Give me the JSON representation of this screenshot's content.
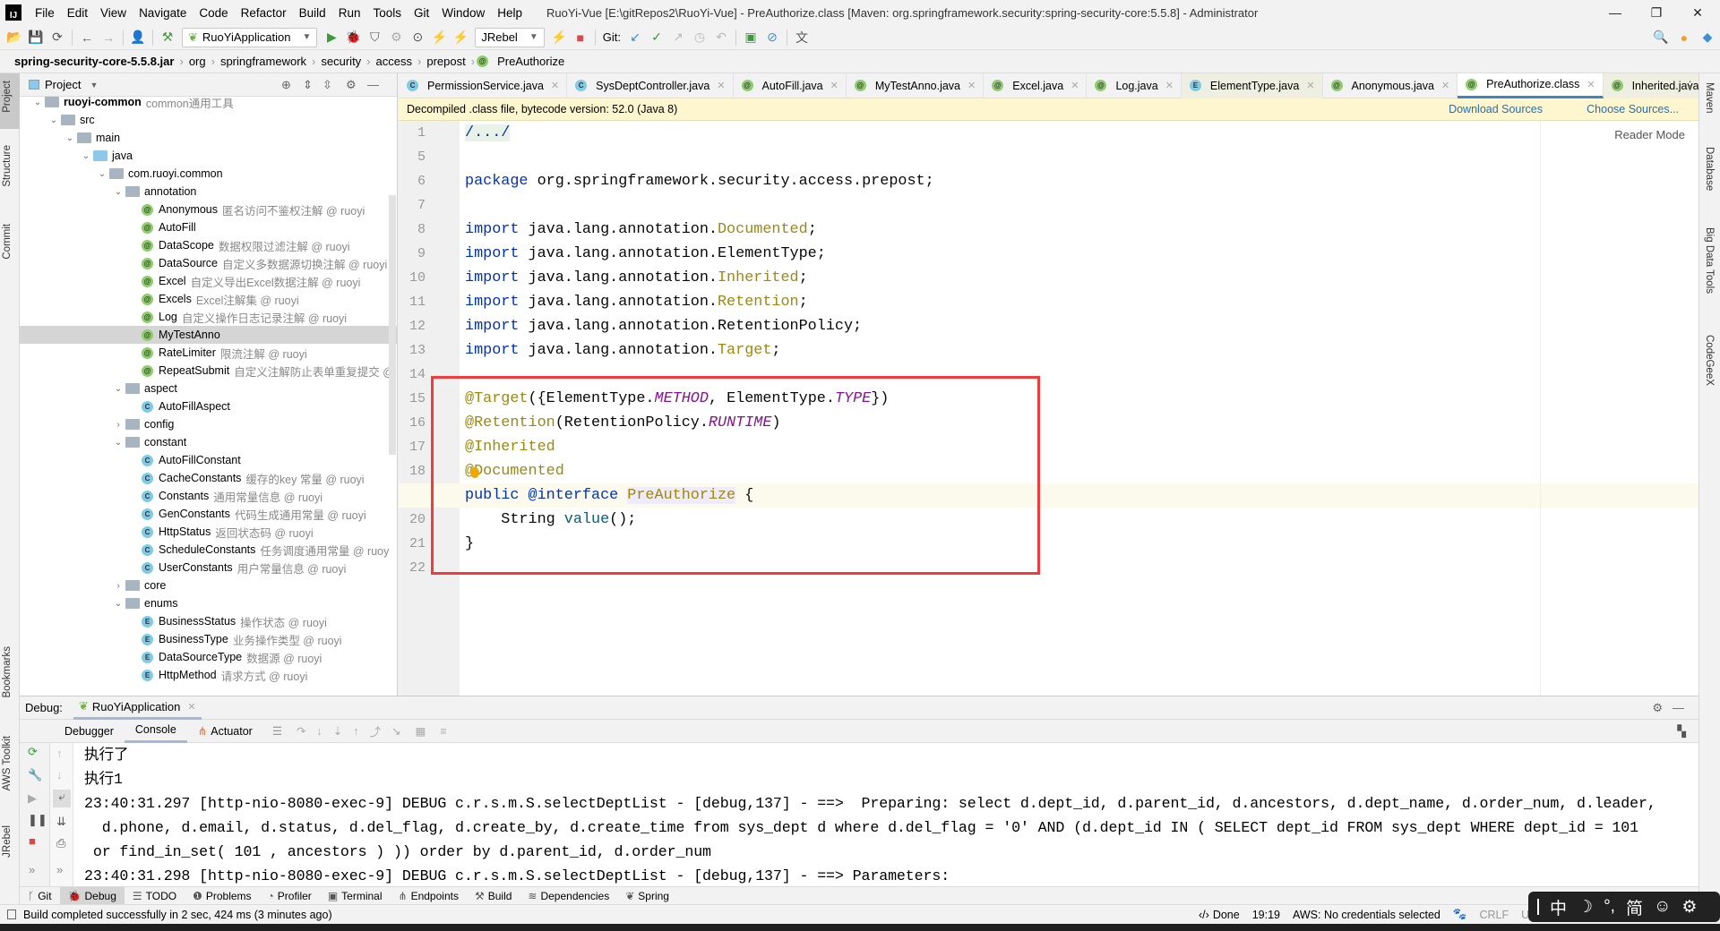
{
  "window": {
    "title": "RuoYi-Vue [E:\\gitRepos2\\RuoYi-Vue] - PreAuthorize.class [Maven: org.springframework.security:spring-security-core:5.5.8] - Administrator",
    "logo": "IJ"
  },
  "menu": [
    "File",
    "Edit",
    "View",
    "Navigate",
    "Code",
    "Refactor",
    "Build",
    "Run",
    "Tools",
    "Git",
    "Window",
    "Help"
  ],
  "toolbar": {
    "run_config": "RuoYiApplication",
    "jrebel": "JRebel",
    "git_label": "Git:"
  },
  "breadcrumb": [
    "spring-security-core-5.5.8.jar",
    "org",
    "springframework",
    "security",
    "access",
    "prepost",
    "PreAuthorize"
  ],
  "left_strip": [
    "Project",
    "Structure",
    "Commit",
    "Bookmarks",
    "AWS Toolkit",
    "JRebel"
  ],
  "right_strip": [
    "Maven",
    "Database",
    "Big Data Tools",
    "CodeGeeX"
  ],
  "project": {
    "title": "Project",
    "tree": [
      {
        "depth": 0,
        "kind": "module",
        "arrow": "down",
        "name": "ruoyi-common",
        "desc": "common通用工具"
      },
      {
        "depth": 1,
        "kind": "folder",
        "arrow": "down",
        "name": "src",
        "desc": ""
      },
      {
        "depth": 2,
        "kind": "folder",
        "arrow": "down",
        "name": "main",
        "desc": ""
      },
      {
        "depth": 3,
        "kind": "src",
        "arrow": "down",
        "name": "java",
        "desc": ""
      },
      {
        "depth": 4,
        "kind": "folder",
        "arrow": "down",
        "name": "com.ruoyi.common",
        "desc": ""
      },
      {
        "depth": 5,
        "kind": "folder",
        "arrow": "down",
        "name": "annotation",
        "desc": ""
      },
      {
        "depth": 6,
        "kind": "a",
        "name": "Anonymous",
        "desc": "匿名访问不鉴权注解 @ ruoyi"
      },
      {
        "depth": 6,
        "kind": "a",
        "name": "AutoFill",
        "desc": ""
      },
      {
        "depth": 6,
        "kind": "a",
        "name": "DataScope",
        "desc": "数据权限过滤注解 @ ruoyi"
      },
      {
        "depth": 6,
        "kind": "a",
        "name": "DataSource",
        "desc": "自定义多数据源切换注解 @ ruoyi"
      },
      {
        "depth": 6,
        "kind": "a",
        "name": "Excel",
        "desc": "自定义导出Excel数据注解 @ ruoyi"
      },
      {
        "depth": 6,
        "kind": "a",
        "name": "Excels",
        "desc": "Excel注解集 @ ruoyi"
      },
      {
        "depth": 6,
        "kind": "a",
        "name": "Log",
        "desc": "自定义操作日志记录注解 @ ruoyi"
      },
      {
        "depth": 6,
        "kind": "a",
        "name": "MyTestAnno",
        "desc": "",
        "selected": true
      },
      {
        "depth": 6,
        "kind": "a",
        "name": "RateLimiter",
        "desc": "限流注解 @ ruoyi"
      },
      {
        "depth": 6,
        "kind": "a",
        "name": "RepeatSubmit",
        "desc": "自定义注解防止表单重复提交 @"
      },
      {
        "depth": 5,
        "kind": "folder",
        "arrow": "down",
        "name": "aspect",
        "desc": ""
      },
      {
        "depth": 6,
        "kind": "c",
        "name": "AutoFillAspect",
        "desc": ""
      },
      {
        "depth": 5,
        "kind": "folder",
        "arrow": "right",
        "name": "config",
        "desc": ""
      },
      {
        "depth": 5,
        "kind": "folder",
        "arrow": "down",
        "name": "constant",
        "desc": ""
      },
      {
        "depth": 6,
        "kind": "c",
        "name": "AutoFillConstant",
        "desc": ""
      },
      {
        "depth": 6,
        "kind": "c",
        "name": "CacheConstants",
        "desc": "缓存的key 常量 @ ruoyi"
      },
      {
        "depth": 6,
        "kind": "c",
        "name": "Constants",
        "desc": "通用常量信息 @ ruoyi"
      },
      {
        "depth": 6,
        "kind": "c",
        "name": "GenConstants",
        "desc": "代码生成通用常量 @ ruoyi"
      },
      {
        "depth": 6,
        "kind": "c",
        "name": "HttpStatus",
        "desc": "返回状态码 @ ruoyi"
      },
      {
        "depth": 6,
        "kind": "c",
        "name": "ScheduleConstants",
        "desc": "任务调度通用常量 @ ruoy"
      },
      {
        "depth": 6,
        "kind": "c",
        "name": "UserConstants",
        "desc": "用户常量信息 @ ruoyi"
      },
      {
        "depth": 5,
        "kind": "folder",
        "arrow": "right",
        "name": "core",
        "desc": ""
      },
      {
        "depth": 5,
        "kind": "folder",
        "arrow": "down",
        "name": "enums",
        "desc": ""
      },
      {
        "depth": 6,
        "kind": "e",
        "name": "BusinessStatus",
        "desc": "操作状态 @ ruoyi"
      },
      {
        "depth": 6,
        "kind": "e",
        "name": "BusinessType",
        "desc": "业务操作类型 @ ruoyi"
      },
      {
        "depth": 6,
        "kind": "e",
        "name": "DataSourceType",
        "desc": "数据源 @ ruoyi"
      },
      {
        "depth": 6,
        "kind": "e",
        "name": "HttpMethod",
        "desc": "请求方式 @ ruoyi"
      }
    ]
  },
  "tabs": [
    {
      "label": "PermissionService.java",
      "kind": "c"
    },
    {
      "label": "SysDeptController.java",
      "kind": "c"
    },
    {
      "label": "AutoFill.java",
      "kind": "a"
    },
    {
      "label": "MyTestAnno.java",
      "kind": "a"
    },
    {
      "label": "Excel.java",
      "kind": "a"
    },
    {
      "label": "Log.java",
      "kind": "a"
    },
    {
      "label": "ElementType.java",
      "kind": "e",
      "yellow": true
    },
    {
      "label": "Anonymous.java",
      "kind": "a"
    },
    {
      "label": "PreAuthorize.class",
      "kind": "a",
      "active": true
    },
    {
      "label": "Inherited.java",
      "kind": "a",
      "yellow": true
    }
  ],
  "banner": {
    "text": "Decompiled .class file, bytecode version: 52.0 (Java 8)",
    "download": "Download Sources",
    "choose": "Choose Sources..."
  },
  "editor": {
    "reader_mode": "Reader Mode",
    "current_line": 19,
    "lines": [
      {
        "n": 1,
        "t": [
          [
            "/.../",
            "fold"
          ]
        ]
      },
      {
        "n": 5,
        "t": []
      },
      {
        "n": 6,
        "t": [
          [
            "package ",
            "kw"
          ],
          [
            "org.springframework.security.access.prepost;",
            ""
          ]
        ]
      },
      {
        "n": 7,
        "t": []
      },
      {
        "n": 8,
        "t": [
          [
            "import ",
            "kw"
          ],
          [
            "java.lang.annotation.",
            ""
          ],
          [
            "Documented",
            "cls"
          ],
          [
            ";",
            ""
          ]
        ]
      },
      {
        "n": 9,
        "t": [
          [
            "import ",
            "kw"
          ],
          [
            "java.lang.annotation.ElementType;",
            ""
          ]
        ]
      },
      {
        "n": 10,
        "t": [
          [
            "import ",
            "kw"
          ],
          [
            "java.lang.annotation.",
            ""
          ],
          [
            "Inherited",
            "cls"
          ],
          [
            ";",
            ""
          ]
        ]
      },
      {
        "n": 11,
        "t": [
          [
            "import ",
            "kw"
          ],
          [
            "java.lang.annotation.",
            ""
          ],
          [
            "Retention",
            "cls"
          ],
          [
            ";",
            ""
          ]
        ]
      },
      {
        "n": 12,
        "t": [
          [
            "import ",
            "kw"
          ],
          [
            "java.lang.annotation.RetentionPolicy;",
            ""
          ]
        ]
      },
      {
        "n": 13,
        "t": [
          [
            "import ",
            "kw"
          ],
          [
            "java.lang.annotation.",
            ""
          ],
          [
            "Target",
            "cls"
          ],
          [
            ";",
            ""
          ]
        ]
      },
      {
        "n": 14,
        "t": []
      },
      {
        "n": 15,
        "t": [
          [
            "@Target",
            "ann"
          ],
          [
            "({ElementType.",
            ""
          ],
          [
            "METHOD",
            "const"
          ],
          [
            ", ElementType.",
            ""
          ],
          [
            "TYPE",
            "const"
          ],
          [
            "})",
            ""
          ]
        ]
      },
      {
        "n": 16,
        "t": [
          [
            "@Retention",
            "ann"
          ],
          [
            "(RetentionPolicy.",
            ""
          ],
          [
            "RUNTIME",
            "const"
          ],
          [
            ")",
            ""
          ]
        ]
      },
      {
        "n": 17,
        "t": [
          [
            "@Inherited",
            "ann"
          ]
        ]
      },
      {
        "n": 18,
        "t": [
          [
            "@Documented",
            "ann"
          ]
        ]
      },
      {
        "n": 19,
        "t": [
          [
            "public ",
            "kw"
          ],
          [
            "@interface ",
            "kw"
          ],
          [
            "PreAuthorize",
            "decl"
          ],
          [
            " {",
            ""
          ]
        ]
      },
      {
        "n": 20,
        "t": [
          [
            "    String ",
            ""
          ],
          [
            "value",
            "meth"
          ],
          [
            "();",
            ""
          ]
        ]
      },
      {
        "n": 21,
        "t": [
          [
            "}",
            ""
          ]
        ]
      },
      {
        "n": 22,
        "t": []
      }
    ]
  },
  "debug": {
    "label": "Debug:",
    "session": "RuoYiApplication",
    "tabs": [
      "Debugger",
      "Console",
      "Actuator"
    ],
    "active_tab": "Console",
    "console": [
      "执行了",
      "执行1",
      "23:40:31.297 [http-nio-8080-exec-9] DEBUG c.r.s.m.S.selectDeptList - [debug,137] - ==>  Preparing: select d.dept_id, d.parent_id, d.ancestors, d.dept_name, d.order_num, d.leader,",
      "  d.phone, d.email, d.status, d.del_flag, d.create_by, d.create_time from sys_dept d where d.del_flag = '0' AND (d.dept_id IN ( SELECT dept_id FROM sys_dept WHERE dept_id = 101",
      " or find_in_set( 101 , ancestors ) )) order by d.parent_id, d.order_num",
      "23:40:31.298 [http-nio-8080-exec-9] DEBUG c.r.s.m.S.selectDeptList - [debug,137] - ==> Parameters:"
    ]
  },
  "bottom_tabs": [
    {
      "label": "Git",
      "icon": "git-branch-icon"
    },
    {
      "label": "Debug",
      "icon": "bug-icon",
      "active": true
    },
    {
      "label": "TODO",
      "icon": "list-icon"
    },
    {
      "label": "Problems",
      "icon": "warning-icon"
    },
    {
      "label": "Profiler",
      "icon": "profiler-icon"
    },
    {
      "label": "Terminal",
      "icon": "terminal-icon"
    },
    {
      "label": "Endpoints",
      "icon": "endpoints-icon"
    },
    {
      "label": "Build",
      "icon": "hammer-icon"
    },
    {
      "label": "Dependencies",
      "icon": "layers-icon"
    },
    {
      "label": "Spring",
      "icon": "leaf-icon"
    }
  ],
  "status": {
    "message": "Build completed successfully in 2 sec, 424 ms (3 minutes ago)",
    "done": "Done",
    "position": "19:19",
    "aws": "AWS: No credentials selected",
    "line_sep": "CRLF",
    "encoding": "U"
  },
  "ime": [
    "中",
    "☽",
    "°,",
    "简",
    "☺",
    "⚙"
  ],
  "colors": {
    "accent": "#4083c9",
    "highlight_box": "#f03c3c",
    "banner": "#fdf6cf",
    "keyword": "#0033b3",
    "annotation": "#9e880d",
    "constant": "#871094"
  }
}
